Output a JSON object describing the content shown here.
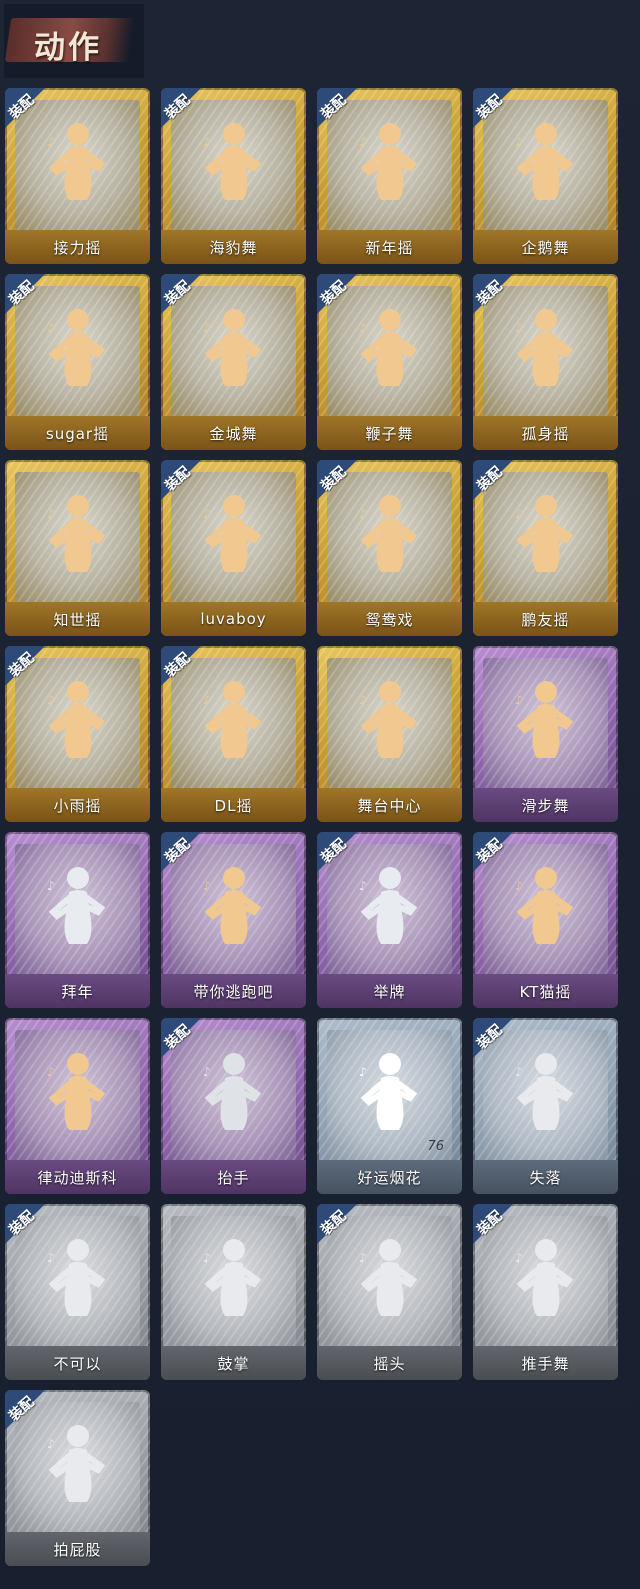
{
  "header": {
    "title": "动作"
  },
  "badge_label": "装配",
  "cards": [
    {
      "label": "接力摇",
      "tier": "gold",
      "equipped": true,
      "figure_color": "#f0c890"
    },
    {
      "label": "海豹舞",
      "tier": "gold",
      "equipped": true,
      "figure_color": "#f0c890"
    },
    {
      "label": "新年摇",
      "tier": "gold",
      "equipped": true,
      "figure_color": "#f0c890"
    },
    {
      "label": "企鹅舞",
      "tier": "gold",
      "equipped": true,
      "figure_color": "#f0c890"
    },
    {
      "label": "sugar摇",
      "tier": "gold",
      "equipped": true,
      "figure_color": "#f0c890"
    },
    {
      "label": "金城舞",
      "tier": "gold",
      "equipped": true,
      "figure_color": "#f0c890"
    },
    {
      "label": "鞭子舞",
      "tier": "gold",
      "equipped": true,
      "figure_color": "#f0c890"
    },
    {
      "label": "孤身摇",
      "tier": "gold",
      "equipped": true,
      "figure_color": "#f0c890"
    },
    {
      "label": "知世摇",
      "tier": "gold",
      "equipped": false,
      "figure_color": "#f0c890"
    },
    {
      "label": "luvaboy",
      "tier": "gold",
      "equipped": true,
      "figure_color": "#f0c890"
    },
    {
      "label": "鸳鸯戏",
      "tier": "gold",
      "equipped": true,
      "figure_color": "#f0c890"
    },
    {
      "label": "鹏友摇",
      "tier": "gold",
      "equipped": true,
      "figure_color": "#f0c890"
    },
    {
      "label": "小雨摇",
      "tier": "gold",
      "equipped": true,
      "figure_color": "#f0c890"
    },
    {
      "label": "DL摇",
      "tier": "gold",
      "equipped": true,
      "figure_color": "#f0c890"
    },
    {
      "label": "舞台中心",
      "tier": "gold",
      "equipped": false,
      "figure_color": "#f0c890"
    },
    {
      "label": "滑步舞",
      "tier": "purple",
      "equipped": false,
      "figure_color": "#f0c890"
    },
    {
      "label": "拜年",
      "tier": "purple",
      "equipped": false,
      "figure_color": "#e8ecf0"
    },
    {
      "label": "带你逃跑吧",
      "tier": "purple",
      "equipped": true,
      "figure_color": "#f0c890"
    },
    {
      "label": "举牌",
      "tier": "purple",
      "equipped": true,
      "figure_color": "#e8ecf0"
    },
    {
      "label": "KT猫摇",
      "tier": "purple",
      "equipped": true,
      "figure_color": "#f0c890"
    },
    {
      "label": "律动迪斯科",
      "tier": "purple",
      "equipped": false,
      "figure_color": "#f0c890"
    },
    {
      "label": "抬手",
      "tier": "purple",
      "equipped": true,
      "figure_color": "#dfe2e6"
    },
    {
      "label": "好运烟花",
      "tier": "blue",
      "equipped": false,
      "figure_color": "#ffffff",
      "count": "76"
    },
    {
      "label": "失落",
      "tier": "blue",
      "equipped": true,
      "figure_color": "#e8eaee"
    },
    {
      "label": "不可以",
      "tier": "grey",
      "equipped": true,
      "figure_color": "#e8eaee"
    },
    {
      "label": "鼓掌",
      "tier": "grey",
      "equipped": false,
      "figure_color": "#e8eaee"
    },
    {
      "label": "摇头",
      "tier": "grey",
      "equipped": true,
      "figure_color": "#e8eaee"
    },
    {
      "label": "推手舞",
      "tier": "grey",
      "equipped": true,
      "figure_color": "#e8eaee"
    },
    {
      "label": "拍屁股",
      "tier": "grey",
      "equipped": true,
      "figure_color": "#e8eaee"
    }
  ]
}
